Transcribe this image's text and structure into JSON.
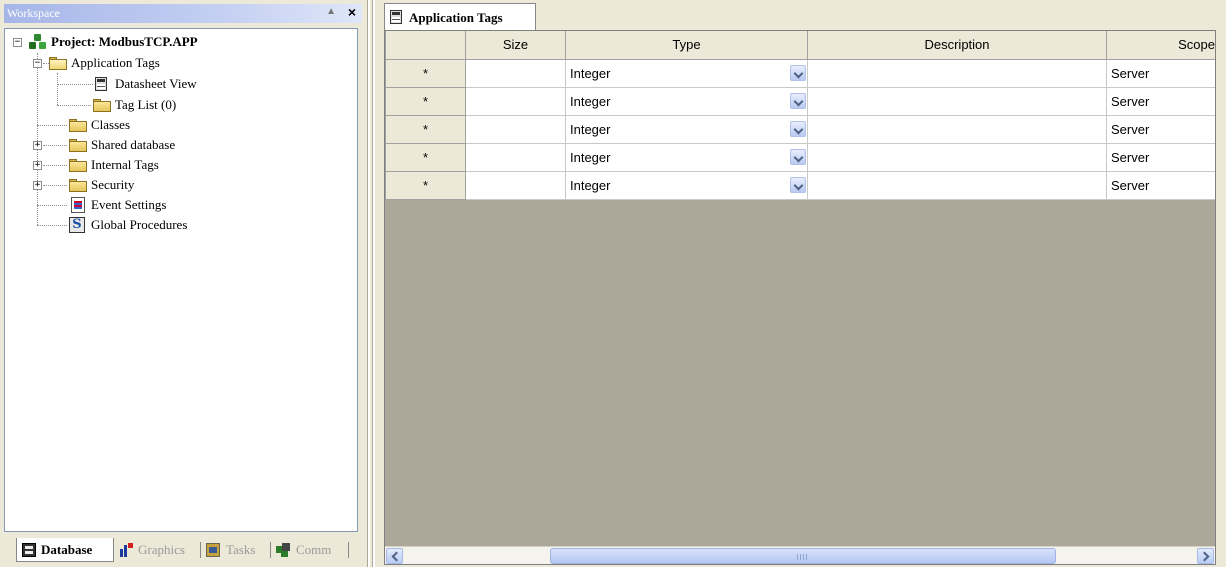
{
  "workspace": {
    "title": "Workspace",
    "pin_glyph": "▲",
    "close_glyph": "×",
    "tree": {
      "project": "Project: ModbusTCP.APP",
      "application_tags": "Application Tags",
      "datasheet_view": "Datasheet View",
      "tag_list": "Tag List (0)",
      "classes": "Classes",
      "shared_database": "Shared database",
      "internal_tags": "Internal Tags",
      "security": "Security",
      "event_settings": "Event Settings",
      "global_procedures": "Global Procedures"
    },
    "tabs": {
      "database": "Database",
      "graphics": "Graphics",
      "tasks": "Tasks",
      "comm": "Comm"
    }
  },
  "document": {
    "tab_label": "Application Tags",
    "columns": [
      "",
      "Size",
      "Type",
      "Description",
      "Scope"
    ],
    "rows": [
      {
        "marker": "*",
        "size": "",
        "type": "Integer",
        "description": "",
        "scope": "Server"
      },
      {
        "marker": "*",
        "size": "",
        "type": "Integer",
        "description": "",
        "scope": "Server"
      },
      {
        "marker": "*",
        "size": "",
        "type": "Integer",
        "description": "",
        "scope": "Server"
      },
      {
        "marker": "*",
        "size": "",
        "type": "Integer",
        "description": "",
        "scope": "Server"
      },
      {
        "marker": "*",
        "size": "",
        "type": "Integer",
        "description": "",
        "scope": "Server"
      }
    ]
  },
  "colors": {
    "titlebar": "#a6b6e8",
    "grid_background": "#aca899",
    "panel": "#ece9d8"
  }
}
